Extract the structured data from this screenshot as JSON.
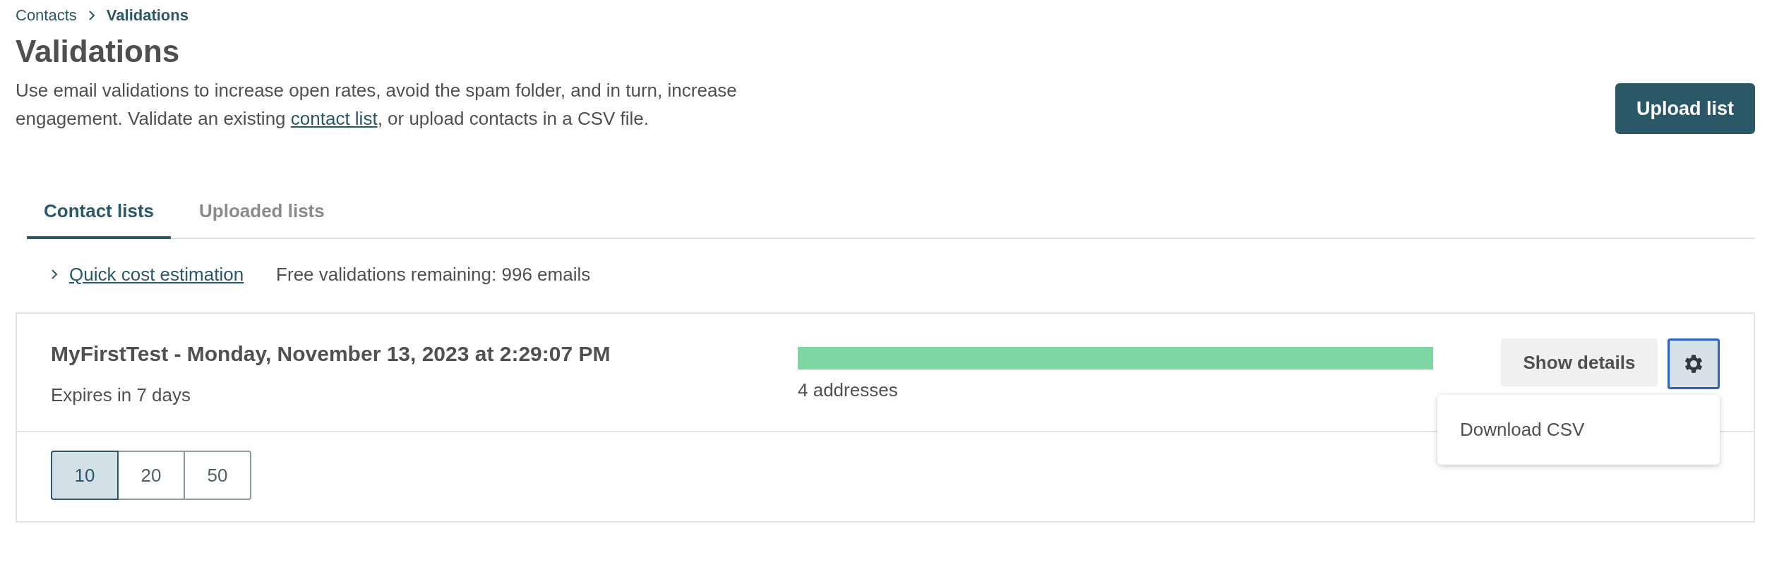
{
  "breadcrumb": [
    {
      "label": "Contacts",
      "current": false
    },
    {
      "label": "Validations",
      "current": true
    }
  ],
  "title": "Validations",
  "description": {
    "before": "Use email validations to increase open rates, avoid the spam folder, and in turn, increase engagement. Validate an existing ",
    "link": "contact list",
    "after": ", or upload contacts in a CSV file."
  },
  "upload_button": "Upload list",
  "tabs": [
    {
      "label": "Contact lists",
      "selected": true
    },
    {
      "label": "Uploaded lists",
      "selected": false
    }
  ],
  "cost_estimation": {
    "link": "Quick cost estimation",
    "expanded": false
  },
  "free_validations": "Free validations remaining: 996 emails",
  "validations": [
    {
      "name": "MyFirstTest - Monday, November 13, 2023 at 2:29:07 PM",
      "expires": "Expires in 7 days",
      "level": 1,
      "addresses": "4 addresses",
      "details_button": "Show details",
      "menu_open": true,
      "menu_items": [
        "Download CSV"
      ]
    }
  ],
  "page_sizes": [
    {
      "label": "10",
      "selected": true
    },
    {
      "label": "20",
      "selected": false
    },
    {
      "label": "50",
      "selected": false
    }
  ]
}
